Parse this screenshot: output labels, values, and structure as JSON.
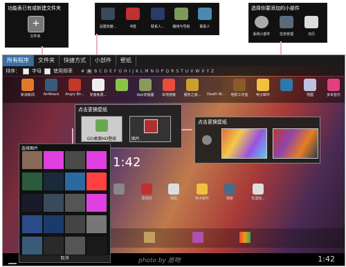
{
  "callouts": {
    "top_left": {
      "caption": "功能表已有或新建文件夹",
      "item_label": "文件夹"
    },
    "top_mid": {
      "items": [
        "设置快捷...",
        "书签",
        "联系人...",
        "路线与导航",
        "联系人"
      ]
    },
    "top_right": {
      "caption": "选择你要添加的小部件",
      "items": [
        "系统小部件",
        "任务管理",
        "日历"
      ]
    },
    "wallpaper_1": {
      "title": "点击更换壁纸",
      "options": [
        "GO桌面HD壁纸",
        "图片"
      ]
    },
    "wallpaper_2": {
      "title": "点击更换壁纸"
    }
  },
  "tabs": [
    {
      "label": "所有程序",
      "active": true
    },
    {
      "label": "文件夹",
      "active": false
    },
    {
      "label": "快捷方式",
      "active": false
    },
    {
      "label": "小部件",
      "active": false
    },
    {
      "label": "壁纸",
      "active": false
    }
  ],
  "sortbar": {
    "sort_label": "排序：",
    "option_alpha": "字母",
    "option_freq": "使用频率",
    "letters": [
      "#",
      "A",
      "B",
      "C",
      "D",
      "E",
      "F",
      "G",
      "H",
      "I",
      "J",
      "K",
      "L",
      "M",
      "N",
      "O",
      "P",
      "Q",
      "R",
      "S",
      "T",
      "U",
      "V",
      "W",
      "X",
      "Y",
      "Z"
    ]
  },
  "apps": [
    "新浪新闻",
    "AirAttack",
    "Angry Bir...",
    "安装免费...",
    "",
    "Apk安装器",
    "本地搜索",
    "服务之旅...",
    "Death W...",
    "电影工作室",
    "电子邮件",
    "",
    "地图",
    "多米音乐"
  ],
  "picker": {
    "title": "选择图片",
    "footer": "取消"
  },
  "clock": {
    "time": "1:42"
  },
  "home_labels": [
    "",
    "录音机",
    "相机",
    "电子邮件",
    "相册",
    "优酒馆..."
  ],
  "status": {
    "time": "1:42",
    "watermark": "photo by 愿吻"
  },
  "accent": "#3a6ea5"
}
